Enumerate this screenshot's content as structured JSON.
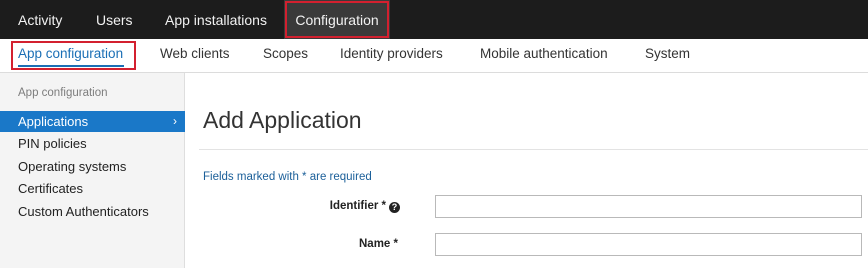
{
  "topnav": {
    "items": [
      "Activity",
      "Users",
      "App installations",
      "Configuration"
    ],
    "active": "Configuration"
  },
  "subnav": {
    "items": [
      "App configuration",
      "Web clients",
      "Scopes",
      "Identity providers",
      "Mobile authentication",
      "System"
    ],
    "active": "App configuration"
  },
  "sidebar": {
    "heading": "App configuration",
    "items": [
      "Applications",
      "PIN policies",
      "Operating systems",
      "Certificates",
      "Custom Authenticators"
    ],
    "selected": "Applications",
    "chevron": "›"
  },
  "main": {
    "title": "Add Application",
    "required_note": "Fields marked with * are required",
    "fields": [
      {
        "label": "Identifier *",
        "value": "",
        "help_icon": "?"
      },
      {
        "label": "Name *",
        "value": ""
      }
    ]
  },
  "colors": {
    "topnav_bg": "#1c1c1c",
    "accent_blue": "#1a78c8",
    "highlight_red": "#d3202f"
  }
}
